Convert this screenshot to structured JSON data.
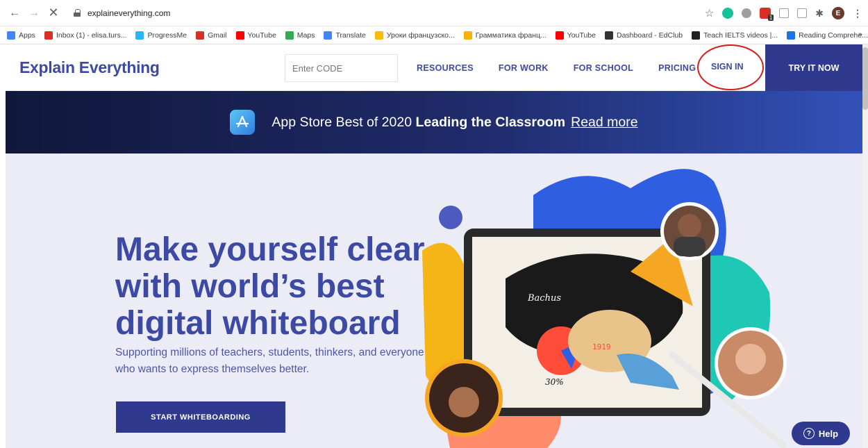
{
  "browser": {
    "url": "explaineverything.com",
    "profile_initial": "E",
    "extension_badge": "1"
  },
  "bookmarks": [
    {
      "label": "Apps",
      "color": "#4285f4"
    },
    {
      "label": "Inbox (1) - elisa.turs...",
      "color": "#d93025"
    },
    {
      "label": "ProgressMe",
      "color": "#29b6f6"
    },
    {
      "label": "Gmail",
      "color": "#d93025"
    },
    {
      "label": "YouTube",
      "color": "#ff0000"
    },
    {
      "label": "Maps",
      "color": "#34a853"
    },
    {
      "label": "Translate",
      "color": "#4285f4"
    },
    {
      "label": "Уроки французско...",
      "color": "#fbbc05"
    },
    {
      "label": "Грамматика франц...",
      "color": "#f4b400"
    },
    {
      "label": "YouTube",
      "color": "#ff0000"
    },
    {
      "label": "Dashboard - EdClub",
      "color": "#333333"
    },
    {
      "label": "Teach IELTS videos |...",
      "color": "#222222"
    },
    {
      "label": "Reading Comprehe...",
      "color": "#1a73e8"
    }
  ],
  "bookmarks_overflow": "»",
  "site": {
    "logo": "Explain Everything",
    "code_placeholder": "Enter CODE",
    "nav": [
      "RESOURCES",
      "FOR WORK",
      "FOR SCHOOL",
      "PRICING"
    ],
    "sign_in": "SIGN IN",
    "try_it": "TRY IT NOW"
  },
  "banner": {
    "prefix": "App Store Best of 2020 ",
    "bold": "Leading the Classroom",
    "link": "Read more"
  },
  "hero": {
    "title": "Make yourself clear with world’s best digital whiteboard",
    "subtitle": "Supporting millions of teachers, students, thinkers, and everyone who wants to express themselves better.",
    "cta": "START WHITEBOARDING",
    "tablet_labels": [
      "Bachus",
      "1919",
      "30%"
    ]
  },
  "help": "Help",
  "colors": {
    "brand": "#3d4aa3",
    "brand_dark": "#2f3a8f",
    "hero_bg": "#ececf6",
    "annotation": "#d81b1b"
  }
}
